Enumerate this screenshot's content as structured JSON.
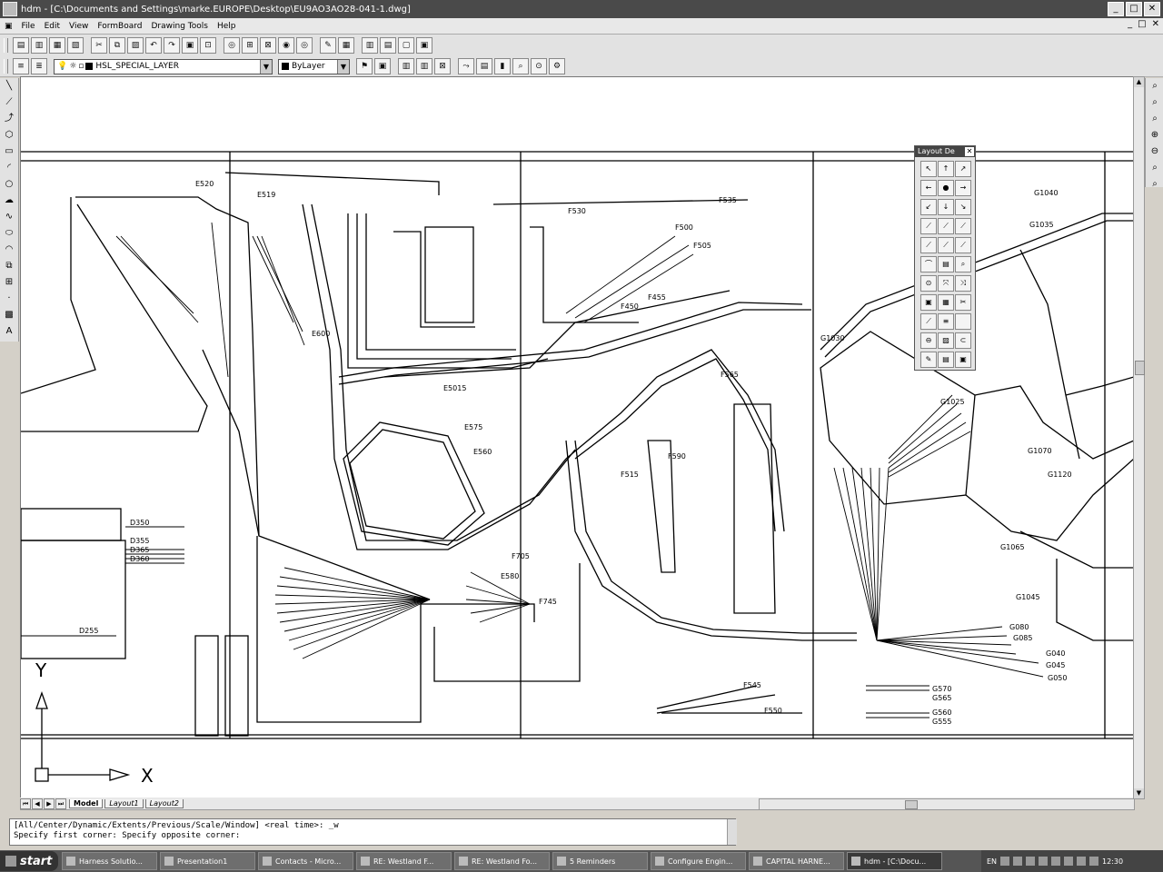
{
  "window": {
    "title": "hdm - [C:\\Documents and Settings\\marke.EUROPE\\Desktop\\EU9AO3AO28-041-1.dwg]",
    "buttons": [
      "_",
      "□",
      "✕"
    ]
  },
  "menu": {
    "items": [
      "File",
      "Edit",
      "View",
      "FormBoard",
      "Drawing Tools",
      "Help"
    ],
    "mdi_buttons": [
      "_",
      "□",
      "✕"
    ]
  },
  "toolbar2": {
    "layer_value": "HSL_SPECIAL_LAYER",
    "color_value": "ByLayer"
  },
  "layout_palette": {
    "title": "Layout De"
  },
  "tabs": [
    "Model",
    "Layout1",
    "Layout2"
  ],
  "command_line": {
    "line1": "[All/Center/Dynamic/Extents/Previous/Scale/Window] <real time>: _w",
    "line2": "Specify first corner: Specify opposite corner:"
  },
  "ucs": {
    "y_label": "Y",
    "x_label": "X"
  },
  "drawing_labels": [
    "E520",
    "E519",
    "F535",
    "F530",
    "F500",
    "F505",
    "E600",
    "F455",
    "F450",
    "E5015",
    "E575",
    "E560",
    "D350",
    "D355",
    "D365",
    "D360",
    "D255",
    "E580",
    "F745",
    "F705",
    "F590",
    "F515",
    "F545",
    "F550",
    "F565",
    "G1035",
    "G1040",
    "G1030",
    "G1025",
    "G1070",
    "G1120",
    "G1065",
    "G1045",
    "G080",
    "G085",
    "G040",
    "G045",
    "G050",
    "G570",
    "G565",
    "G560",
    "G555"
  ],
  "taskbar": {
    "start_label": "start",
    "tasks": [
      "Harness Solutio...",
      "Presentation1",
      "Contacts - Micro...",
      "RE: Westland F...",
      "RE: Westland Fo...",
      "5 Reminders",
      "Configure Engin...",
      "CAPITAL HARNE...",
      "hdm - [C:\\Docu..."
    ],
    "tray_lang": "EN",
    "clock": "12:30"
  }
}
